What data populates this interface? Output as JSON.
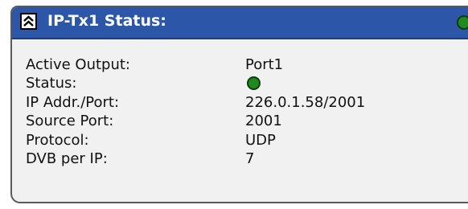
{
  "panel": {
    "title": "IP-Tx1 Status:",
    "collapse_icon": "double-chevron-up-icon",
    "header_status_color": "#1f8a1f",
    "header_color": "#2c57a8"
  },
  "rows": [
    {
      "label": "Active Output:",
      "value": "Port1"
    },
    {
      "label": "Status:",
      "value": "",
      "indicator": "green-status-dot"
    },
    {
      "label": "IP Addr./Port:",
      "value": "226.0.1.58/2001"
    },
    {
      "label": "Source Port:",
      "value": "2001"
    },
    {
      "label": "Protocol:",
      "value": "UDP"
    },
    {
      "label": "DVB per IP:",
      "value": "7"
    }
  ]
}
